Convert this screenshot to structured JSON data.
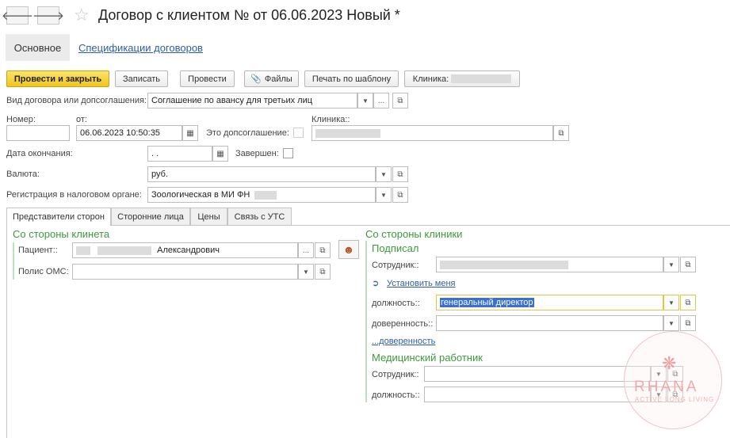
{
  "header": {
    "back_icon": "arrow-left-icon",
    "forward_icon": "arrow-right-icon",
    "favorite_icon": "star-icon",
    "title": "Договор с клиентом №  от 06.06.2023 Новый *"
  },
  "nav_tabs": {
    "main": "Основное",
    "specs": "Спецификации договоров"
  },
  "toolbar": {
    "post_close": "Провести и закрыть",
    "save": "Записать",
    "post": "Провести",
    "files": "Файлы",
    "print_template": "Печать по шаблону",
    "clinic": "Клиника:"
  },
  "form": {
    "contract_type_label": "Вид договора или допсоглашения:",
    "contract_type_value": "Соглашение по авансу для третьих лиц",
    "number_label": "Номер:",
    "from_label": "от:",
    "date_value": "06.06.2023 10:50:35",
    "is_addendum_label": "Это допсоглашение:",
    "clinic_label": "Клиника::",
    "end_date_label": "Дата окончания:",
    "end_date_value": " .  .",
    "completed_label": "Завершен:",
    "currency_label": "Валюта:",
    "currency_value": "руб.",
    "tax_reg_label": "Регистрация в налоговом органе:",
    "tax_reg_value": "Зоологическая в МИ ФН"
  },
  "panel_tabs": [
    "Представители сторон",
    "Сторонние лица",
    "Цены",
    "Связь с УТС"
  ],
  "client_side": {
    "heading": "Со стороны клинета",
    "patient_label": "Пациент::",
    "patient_value": "Александрович",
    "oms_label": "Полис ОМС:"
  },
  "clinic_side": {
    "heading": "Со стороны клиники",
    "signed_heading": "Подписал",
    "employee_label": "Сотрудник::",
    "set_me_link": "Установить меня",
    "position_label": "должность::",
    "position_value": "генеральный директор",
    "proxy_label": "доверенность::",
    "proxy_link": "...доверенность",
    "medic_heading": "Медицинский работник",
    "medic_employee_label": "Сотрудник::",
    "medic_position_label": "должность::"
  },
  "watermark": {
    "text": "RHANA",
    "sub": "ACTIVE LONG LIVING"
  }
}
